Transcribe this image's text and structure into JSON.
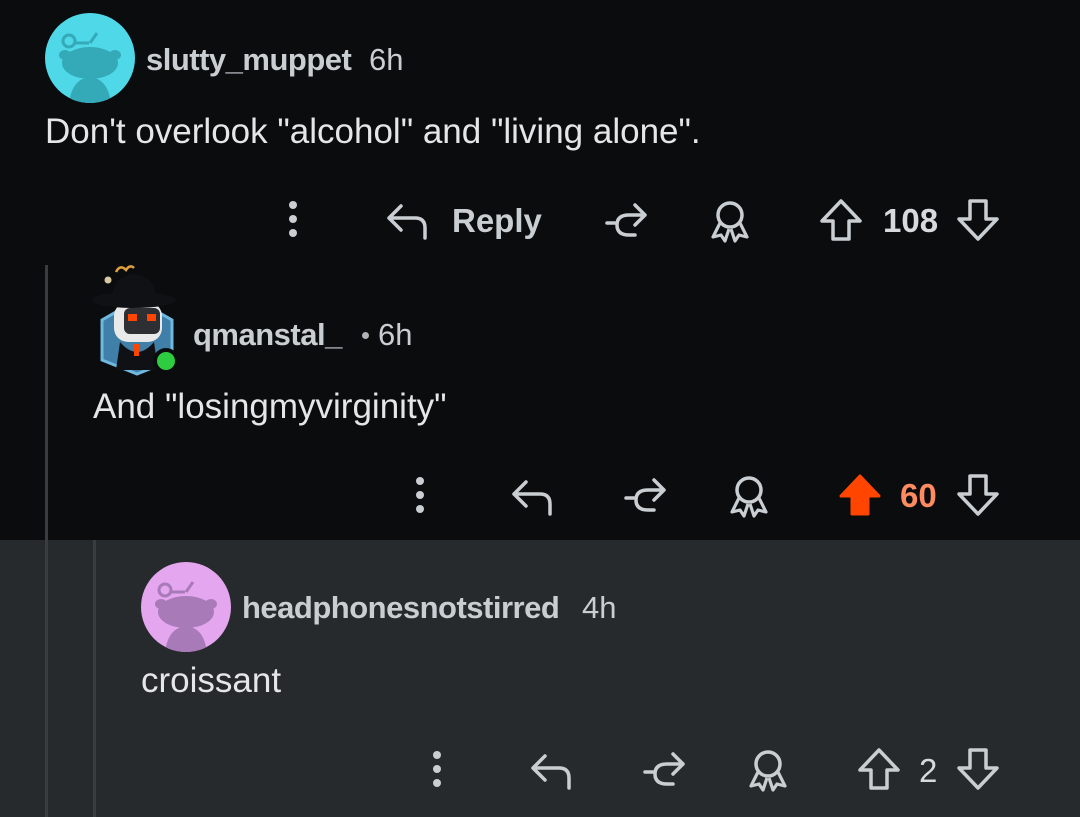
{
  "comments": [
    {
      "username": "slutty_muppet",
      "time": "6h",
      "body": "Don't overlook \"alcohol\" and \"living alone\".",
      "reply_label": "Reply",
      "votes": "108",
      "avatar_color": "#4fd8e8"
    },
    {
      "username": "qmanstal_",
      "time": "6h",
      "body": "And \"losingmyvirginity\"",
      "votes": "60",
      "upvoted": true,
      "online": true,
      "upvote_color": "#ff4500",
      "vote_color": "#ff8b60"
    },
    {
      "username": "headphonesnotstirred",
      "time": "4h",
      "body": "croissant",
      "votes": "2",
      "highlighted": true,
      "avatar_color": "#e3a6ef"
    }
  ],
  "icons": {
    "more": "more-vertical-icon",
    "reply": "reply-arrow-icon",
    "share": "share-icon",
    "award": "award-icon",
    "upvote": "upvote-arrow-icon",
    "downvote": "downvote-arrow-icon"
  }
}
